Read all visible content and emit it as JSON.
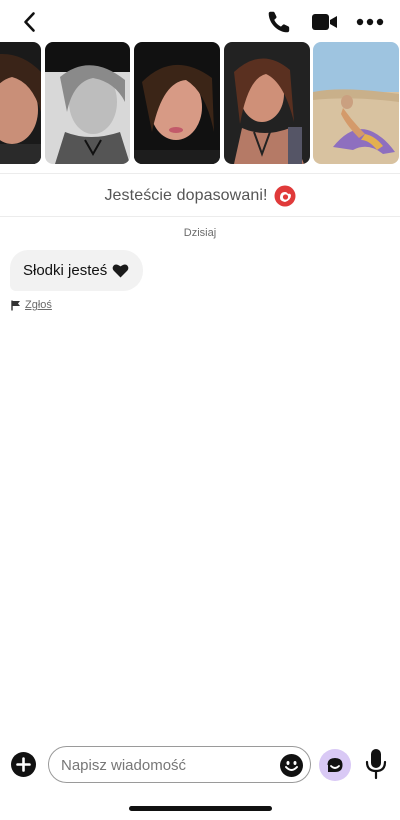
{
  "header": {
    "back_icon": "chevron-left-icon",
    "call_icon": "phone-icon",
    "video_icon": "video-camera-icon",
    "more_icon": "more-dots-icon"
  },
  "photos": [
    {
      "icon": "profile-photo-1"
    },
    {
      "icon": "profile-photo-2"
    },
    {
      "icon": "profile-photo-3"
    },
    {
      "icon": "profile-photo-4"
    },
    {
      "icon": "profile-photo-5"
    }
  ],
  "match": {
    "text": "Jesteście dopasowani!",
    "icon": "match-badge-icon",
    "icon_color": "#e03a3a"
  },
  "chat": {
    "date_label": "Dzisiaj",
    "messages": [
      {
        "text": "Słodki jesteś",
        "emoji_icon": "black-heart-icon"
      }
    ],
    "report_label": "Zgłoś",
    "report_icon": "flag-icon"
  },
  "composer": {
    "placeholder": "Napisz wiadomość",
    "value": "",
    "plus_icon": "plus-circle-icon",
    "emoji_icon": "smiley-icon",
    "ai_icon": "assistant-icon",
    "ai_color": "#d9c9f5",
    "mic_icon": "microphone-icon"
  },
  "colors": {
    "text": "#111111",
    "muted": "#6b6b6b",
    "bubble": "#f2f2f2",
    "divider": "#ececec"
  }
}
